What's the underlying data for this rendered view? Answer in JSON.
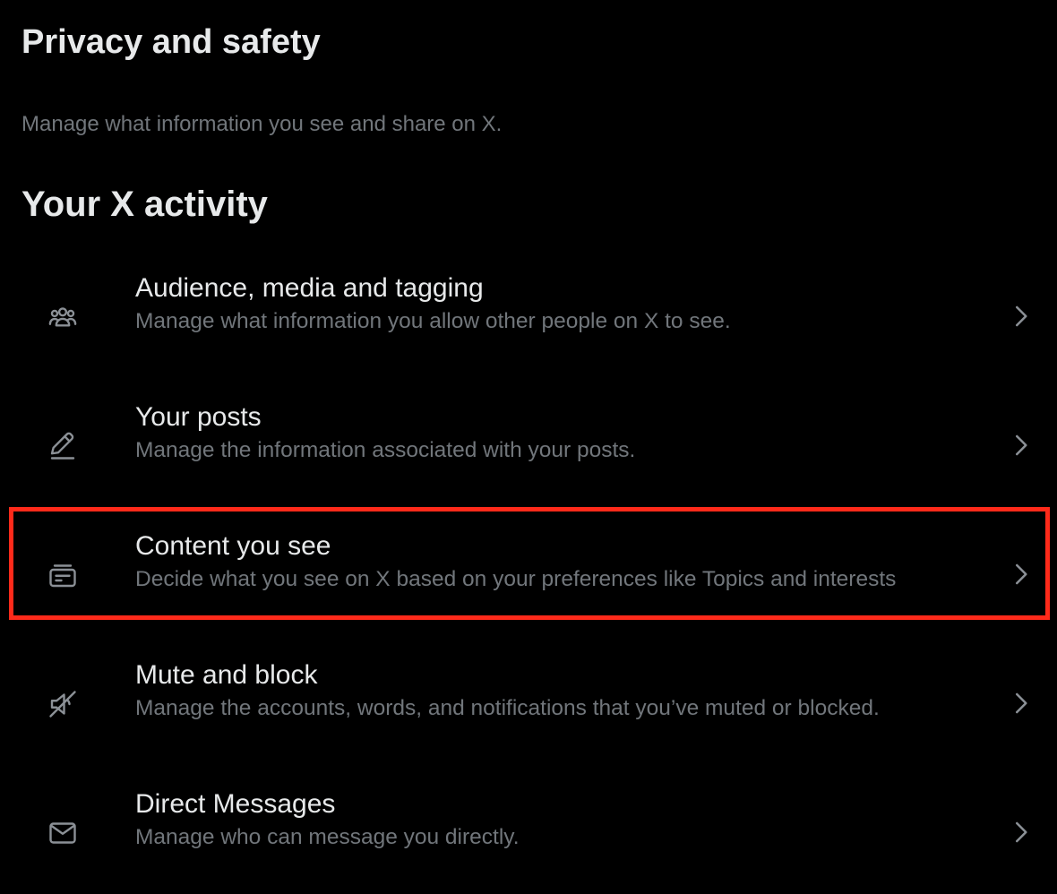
{
  "header": {
    "title": "Privacy and safety",
    "subtitle": "Manage what information you see and share on X."
  },
  "section": {
    "title": "Your X activity"
  },
  "items": [
    {
      "label": "Audience, media and tagging",
      "description": "Manage what information you allow other people on X to see.",
      "icon": "people-icon"
    },
    {
      "label": "Your posts",
      "description": "Manage the information associated with your posts.",
      "icon": "pencil-icon"
    },
    {
      "label": "Content you see",
      "description": "Decide what you see on X based on your preferences like Topics and interests",
      "icon": "content-card-icon",
      "highlighted": true
    },
    {
      "label": "Mute and block",
      "description": "Manage the accounts, words, and notifications that you’ve muted or blocked.",
      "icon": "muted-speaker-icon"
    },
    {
      "label": "Direct Messages",
      "description": "Manage who can message you directly.",
      "icon": "envelope-icon"
    }
  ],
  "colors": {
    "background": "#000000",
    "primary_text": "#e7e9ea",
    "secondary_text": "#71767b",
    "highlight": "#ff2a1a"
  }
}
